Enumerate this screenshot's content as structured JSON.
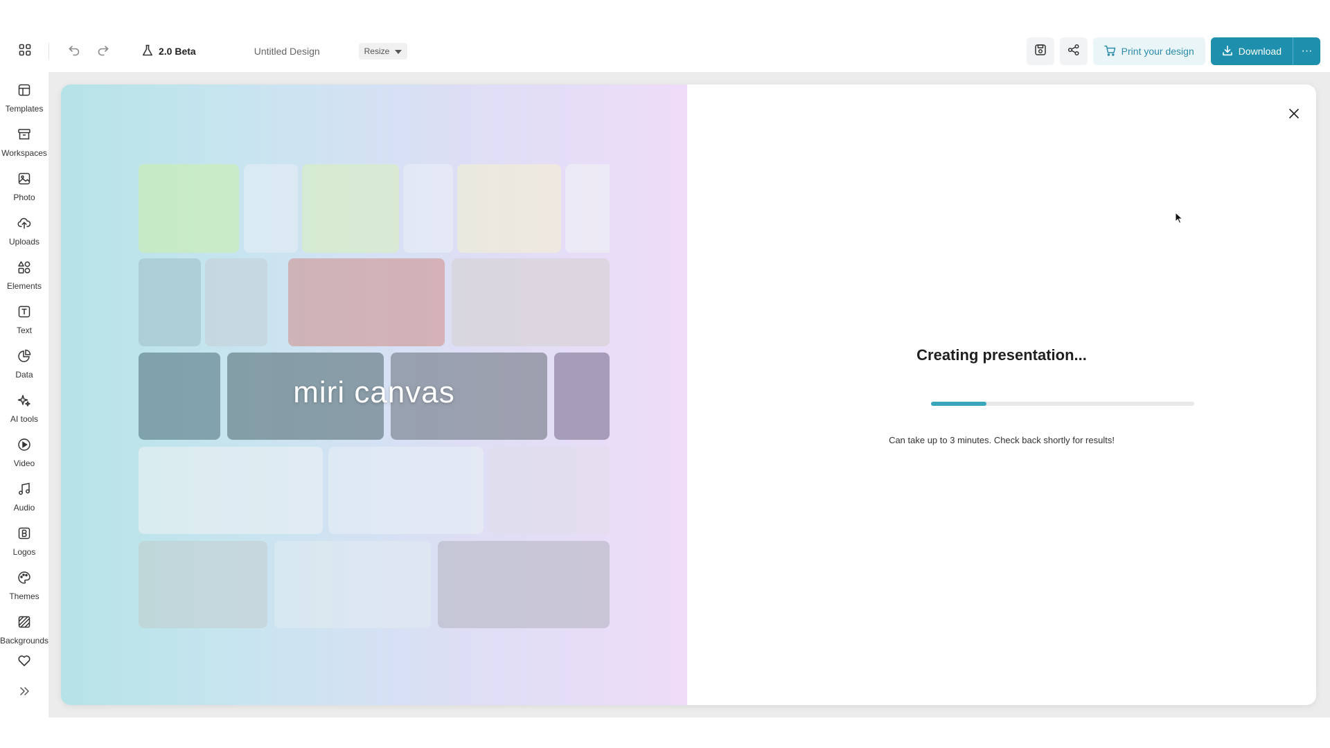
{
  "topbar": {
    "beta_label": "2.0 Beta",
    "document_title": "Untitled Design",
    "resize_label": "Resize",
    "print_label": "Print your design",
    "download_label": "Download",
    "more_label": "···"
  },
  "sidebar": {
    "items": [
      {
        "label": "Templates",
        "icon": "templates-icon"
      },
      {
        "label": "Workspaces",
        "icon": "workspaces-icon"
      },
      {
        "label": "Photo",
        "icon": "photo-icon"
      },
      {
        "label": "Uploads",
        "icon": "uploads-icon"
      },
      {
        "label": "Elements",
        "icon": "elements-icon"
      },
      {
        "label": "Text",
        "icon": "text-icon"
      },
      {
        "label": "Data",
        "icon": "data-icon"
      },
      {
        "label": "AI tools",
        "icon": "ai-tools-icon"
      },
      {
        "label": "Video",
        "icon": "video-icon"
      },
      {
        "label": "Audio",
        "icon": "audio-icon"
      },
      {
        "label": "Logos",
        "icon": "logos-icon"
      },
      {
        "label": "Themes",
        "icon": "themes-icon"
      },
      {
        "label": "Backgrounds",
        "icon": "backgrounds-icon"
      }
    ]
  },
  "modal": {
    "brand": "miri canvas",
    "title": "Creating presentation...",
    "note": "Can take up to 3 minutes. Check back shortly for results!",
    "progress": 0.21
  },
  "colors": {
    "accent": "#1f8fae",
    "progress": "#3aa6bc",
    "print_bg": "#eaf5f8"
  }
}
